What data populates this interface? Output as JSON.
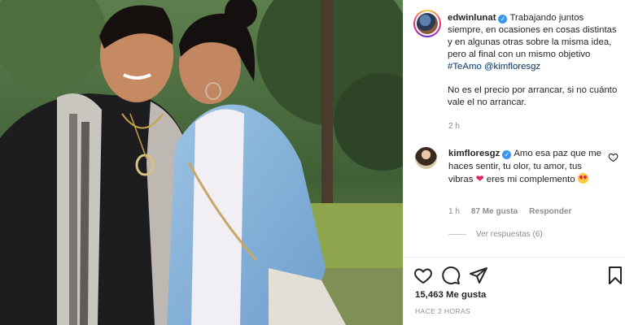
{
  "post": {
    "username": "edwinlunat",
    "caption_p1": "Trabajando juntos siempre, en ocasiones en cosas distintas y en algunas otras sobre la misma idea, pero al final con un mismo objetivo ",
    "hashtag": "#TeAmo",
    "mention": "@kimfloresgz",
    "caption_p2": "No es el precio por arrancar, si no cuánto vale el no arrancar.",
    "time": "2 h"
  },
  "comment": {
    "username": "kimfloresgz",
    "text_a": "Amo esa paz que me haces sentir, tu olor, tu amor, tus vibras ",
    "heart": "❤",
    "text_b": " eres mi complemento ",
    "time": "1 h",
    "likes": "87 Me gusta",
    "reply": "Responder",
    "view_replies": "Ver respuestas (6)"
  },
  "actions": {
    "likes_count": "15,463 Me gusta",
    "posted_ago": "HACE 2 HORAS"
  },
  "icons": {
    "like": "heart-outline-icon",
    "comment": "comment-bubble-icon",
    "share": "paper-plane-icon",
    "save": "bookmark-icon",
    "verified": "verified-badge-icon"
  },
  "colors": {
    "verified": "#3897f0",
    "link": "#00376b",
    "muted": "#8e8e8e",
    "text": "#262626"
  }
}
